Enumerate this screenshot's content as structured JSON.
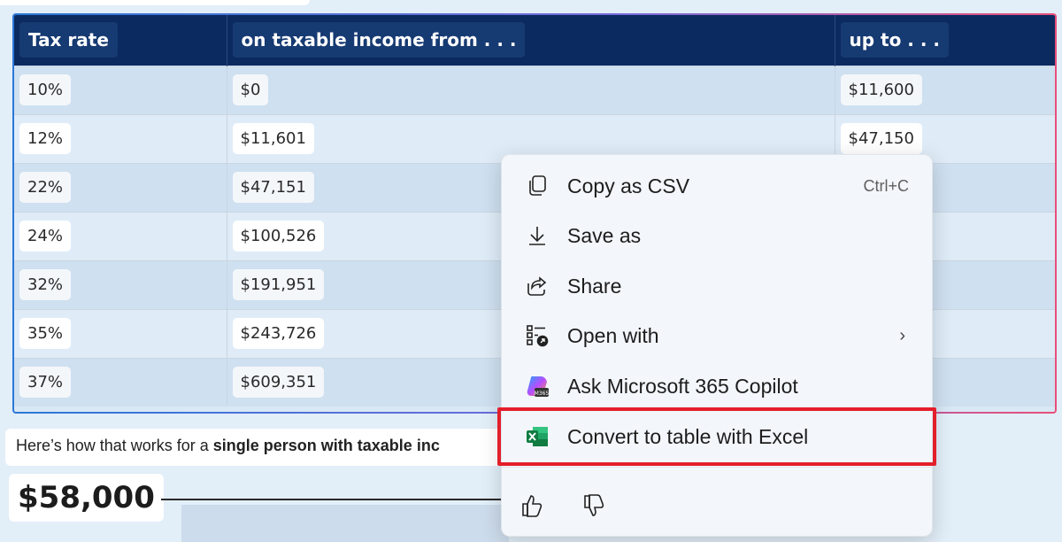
{
  "table": {
    "headers": [
      "Tax rate",
      "on taxable income from . . .",
      "up to . . ."
    ],
    "rows": [
      [
        "10%",
        "$0",
        "$11,600"
      ],
      [
        "12%",
        "$11,601",
        "$47,150"
      ],
      [
        "22%",
        "$47,151",
        ""
      ],
      [
        "24%",
        "$100,526",
        ""
      ],
      [
        "32%",
        "$191,951",
        ""
      ],
      [
        "35%",
        "$243,726",
        ""
      ],
      [
        "37%",
        "$609,351",
        ""
      ]
    ]
  },
  "explanation": {
    "prefix": "Here’s how that works for a ",
    "bold": "single person with taxable inc"
  },
  "amount": "$58,000",
  "context_menu": {
    "items": [
      {
        "label": "Copy as CSV",
        "shortcut": "Ctrl+C",
        "icon": "copy-icon"
      },
      {
        "label": "Save as",
        "icon": "download-icon"
      },
      {
        "label": "Share",
        "icon": "share-icon"
      },
      {
        "label": "Open with",
        "icon": "open-with-icon",
        "submenu_arrow": "›"
      },
      {
        "label": "Ask Microsoft 365 Copilot",
        "icon": "copilot-icon"
      },
      {
        "label": "Convert to table with Excel",
        "icon": "excel-icon"
      }
    ],
    "highlight_color": "#e31f2b",
    "feedback": {
      "like_icon": "thumbs-up-icon",
      "dislike_icon": "thumbs-down-icon"
    }
  },
  "colors": {
    "header_bg": "#0b2a60",
    "accent_border_start": "#2b78d8",
    "accent_border_end": "#e8507a"
  }
}
